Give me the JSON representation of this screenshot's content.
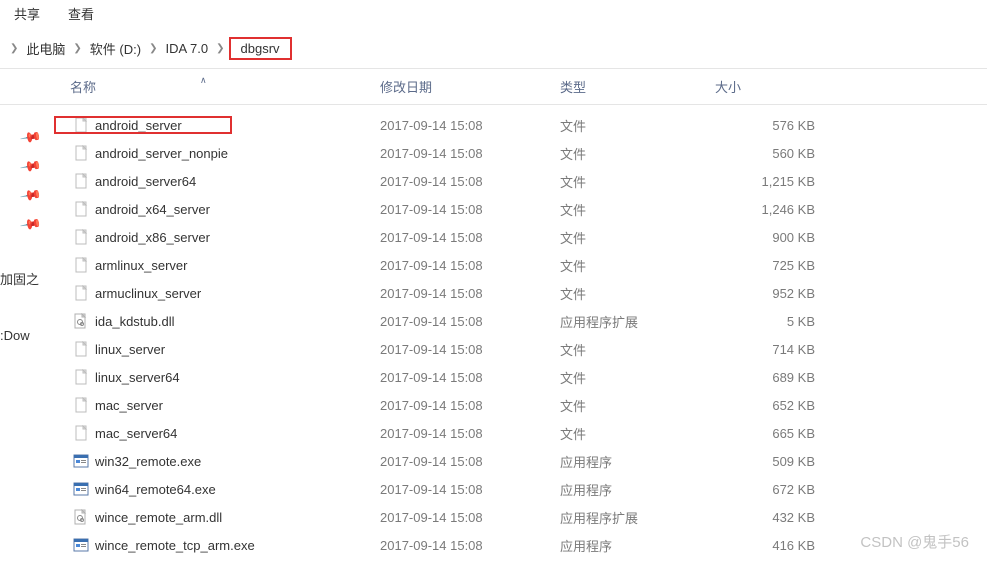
{
  "tabs": {
    "share": "共享",
    "view": "查看"
  },
  "breadcrumb": {
    "items": [
      "此电脑",
      "软件 (D:)",
      "IDA 7.0"
    ],
    "current": "dbgsrv"
  },
  "columns": {
    "name": "名称",
    "date": "修改日期",
    "type": "类型",
    "size": "大小"
  },
  "sidebar": {
    "label1": "加固之",
    "label2": ":Dow"
  },
  "filetypes": {
    "file": "文件",
    "dll": "应用程序扩展",
    "exe": "应用程序"
  },
  "files": [
    {
      "name": "android_server",
      "date": "2017-09-14 15:08",
      "type": "file",
      "size": "576 KB",
      "icon": "blank",
      "hl": true
    },
    {
      "name": "android_server_nonpie",
      "date": "2017-09-14 15:08",
      "type": "file",
      "size": "560 KB",
      "icon": "blank"
    },
    {
      "name": "android_server64",
      "date": "2017-09-14 15:08",
      "type": "file",
      "size": "1,215 KB",
      "icon": "blank"
    },
    {
      "name": "android_x64_server",
      "date": "2017-09-14 15:08",
      "type": "file",
      "size": "1,246 KB",
      "icon": "blank"
    },
    {
      "name": "android_x86_server",
      "date": "2017-09-14 15:08",
      "type": "file",
      "size": "900 KB",
      "icon": "blank"
    },
    {
      "name": "armlinux_server",
      "date": "2017-09-14 15:08",
      "type": "file",
      "size": "725 KB",
      "icon": "blank"
    },
    {
      "name": "armuclinux_server",
      "date": "2017-09-14 15:08",
      "type": "file",
      "size": "952 KB",
      "icon": "blank"
    },
    {
      "name": "ida_kdstub.dll",
      "date": "2017-09-14 15:08",
      "type": "dll",
      "size": "5 KB",
      "icon": "dll"
    },
    {
      "name": "linux_server",
      "date": "2017-09-14 15:08",
      "type": "file",
      "size": "714 KB",
      "icon": "blank"
    },
    {
      "name": "linux_server64",
      "date": "2017-09-14 15:08",
      "type": "file",
      "size": "689 KB",
      "icon": "blank"
    },
    {
      "name": "mac_server",
      "date": "2017-09-14 15:08",
      "type": "file",
      "size": "652 KB",
      "icon": "blank"
    },
    {
      "name": "mac_server64",
      "date": "2017-09-14 15:08",
      "type": "file",
      "size": "665 KB",
      "icon": "blank"
    },
    {
      "name": "win32_remote.exe",
      "date": "2017-09-14 15:08",
      "type": "exe",
      "size": "509 KB",
      "icon": "exe"
    },
    {
      "name": "win64_remote64.exe",
      "date": "2017-09-14 15:08",
      "type": "exe",
      "size": "672 KB",
      "icon": "exe"
    },
    {
      "name": "wince_remote_arm.dll",
      "date": "2017-09-14 15:08",
      "type": "dll",
      "size": "432 KB",
      "icon": "dll"
    },
    {
      "name": "wince_remote_tcp_arm.exe",
      "date": "2017-09-14 15:08",
      "type": "exe",
      "size": "416 KB",
      "icon": "exe"
    }
  ],
  "watermark": "CSDN @鬼手56"
}
